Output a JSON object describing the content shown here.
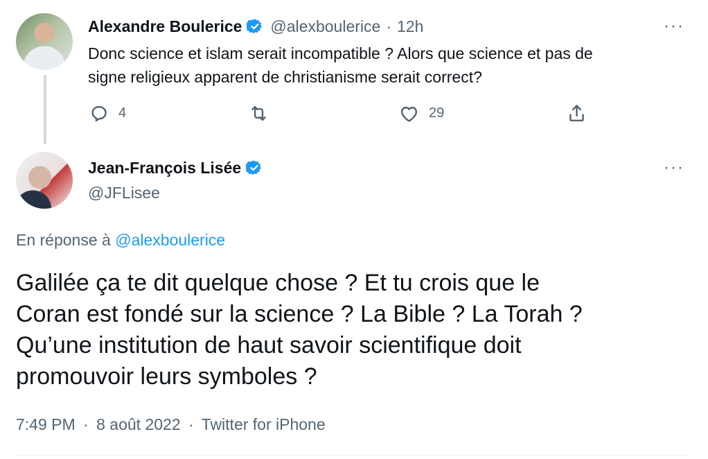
{
  "reply_tweet": {
    "author_name": "Alexandre Boulerice",
    "handle": "@alexboulerice",
    "separator": "·",
    "time": "12h",
    "more": "···",
    "text_line1": "Donc science et islam serait incompatible ? Alors que science et pas de",
    "text_line2": "signe religieux apparent de christianisme serait correct?",
    "reply_count": "4",
    "retweet_count": "",
    "like_count": "29"
  },
  "main_tweet": {
    "author_name": "Jean-François Lisée",
    "handle": "@JFLisee",
    "more": "···",
    "reply_prefix": "En réponse à",
    "reply_mention": "@alexboulerice",
    "text_line1": "Galilée ça te dit quelque chose ? Et tu crois que le",
    "text_line2": "Coran est fondé sur la science ? La Bible ? La Torah ?",
    "text_line3": "Qu’une institution de haut savoir scientifique doit",
    "text_line4": "promouvoir leurs symboles ?",
    "time": "7:49 PM",
    "date": "8 août 2022",
    "source": "Twitter for iPhone",
    "separator": "·"
  },
  "colors": {
    "accent": "#1d9bf0",
    "text": "#0f1419",
    "secondary": "#536471",
    "thread_line": "#cfd9de"
  },
  "icons": [
    "verified-badge-icon",
    "more-icon",
    "reply-icon",
    "retweet-icon",
    "like-icon",
    "share-icon"
  ]
}
